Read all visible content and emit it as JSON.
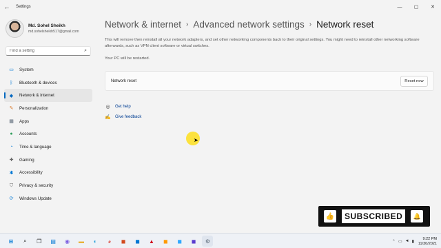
{
  "app": {
    "title": "Settings"
  },
  "user": {
    "name": "Md. Sohel Sheikh",
    "email": "md.sohelsheikh517@gmail.com"
  },
  "search": {
    "placeholder": "Find a setting"
  },
  "sidebar": {
    "items": [
      {
        "label": "System",
        "icon": "monitor-icon",
        "active": false
      },
      {
        "label": "Bluetooth & devices",
        "icon": "bluetooth-icon",
        "active": false
      },
      {
        "label": "Network & internet",
        "icon": "wifi-icon",
        "active": true
      },
      {
        "label": "Personalization",
        "icon": "brush-icon",
        "active": false
      },
      {
        "label": "Apps",
        "icon": "apps-icon",
        "active": false
      },
      {
        "label": "Accounts",
        "icon": "person-icon",
        "active": false
      },
      {
        "label": "Time & language",
        "icon": "globe-clock-icon",
        "active": false
      },
      {
        "label": "Gaming",
        "icon": "gamepad-icon",
        "active": false
      },
      {
        "label": "Accessibility",
        "icon": "accessibility-icon",
        "active": false
      },
      {
        "label": "Privacy & security",
        "icon": "shield-icon",
        "active": false
      },
      {
        "label": "Windows Update",
        "icon": "update-icon",
        "active": false
      }
    ]
  },
  "breadcrumb": {
    "level1": "Network & internet",
    "level2": "Advanced network settings",
    "current": "Network reset",
    "separator": "›"
  },
  "main": {
    "description": "This will remove then reinstall all your network adapters, and set other networking components back to their original settings. You might need to reinstall other networking software afterwards, such as VPN client software or virtual switches.",
    "restart_note": "Your PC will be restarted.",
    "card_label": "Network reset",
    "reset_button": "Reset now",
    "help_link": "Get help",
    "feedback_link": "Give feedback"
  },
  "overlay": {
    "subscribed_text": "SUBSCRIBED"
  },
  "taskbar": {
    "time": "9:22 PM",
    "date": "11/30/2021"
  },
  "colors": {
    "accent": "#0067c0",
    "link": "#003e92",
    "background": "#f3f3f3"
  }
}
